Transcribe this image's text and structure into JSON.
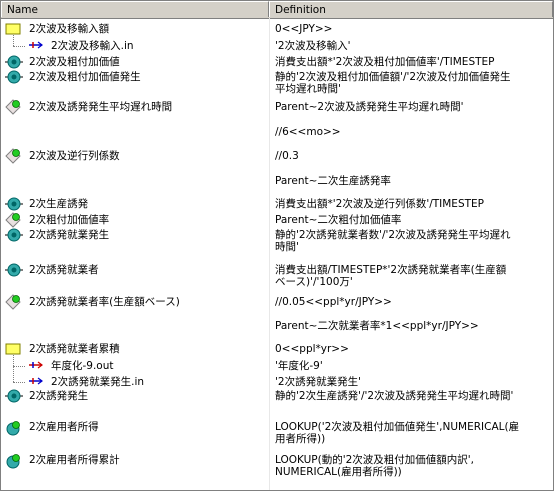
{
  "header": {
    "name_label": "Name",
    "definition_label": "Definition"
  },
  "rows": [
    {
      "name": "2次波及移輸入額",
      "def": [
        "0<<JPY>>"
      ],
      "icon": "level-icon"
    },
    {
      "name": "2次波及移輸入.in",
      "def": [
        "'2次波及移輸入'"
      ],
      "icon": "flow-in-icon"
    },
    {
      "name": "2次波及粗付加価値",
      "def": [
        "消費支出額*'2次波及粗付加価値率'/TIMESTEP"
      ],
      "icon": "flow-valve-icon"
    },
    {
      "name": "2次波及粗付加価値発生",
      "def": [
        "静的'2次波及粗付加価値額'/'2次波及付加価値発生",
        "平均遅れ時間'"
      ],
      "icon": "flow-valve-icon"
    },
    {
      "name": "2次波及誘発発生平均遅れ時間",
      "def": [
        "Parent~2次波及誘発発生平均遅れ時間'"
      ],
      "icon": "constant-icon"
    },
    {
      "name": "",
      "def": [
        "//6<<mo>>"
      ],
      "icon": ""
    },
    {
      "name": "2次波及逆行列係数",
      "def": [
        "//0.3"
      ],
      "icon": "constant-icon"
    },
    {
      "name": "",
      "def": [
        "Parent~二次生産誘発率"
      ],
      "icon": ""
    },
    {
      "name": "2次生産誘発",
      "def": [
        "消費支出額*'2次波及逆行列係数'/TIMESTEP"
      ],
      "icon": "flow-valve-icon"
    },
    {
      "name": "2次粗付加価値率",
      "def": [
        "Parent~二次粗付加価値率"
      ],
      "icon": "constant-icon"
    },
    {
      "name": "2次誘発就業発生",
      "def": [
        "静的'2次誘発就業者数'/'2次波及誘発発生平均遅れ",
        "時間'"
      ],
      "icon": "flow-valve-icon"
    },
    {
      "name": "2次誘発就業者",
      "def": [
        "消費支出額/TIMESTEP*'2次誘発就業者率(生産額",
        "ベース)'/'100万'"
      ],
      "icon": "flow-valve-icon"
    },
    {
      "name": "2次誘発就業者率(生産額ベース)",
      "def": [
        "//0.05<<ppl*yr/JPY>>"
      ],
      "icon": "constant-icon"
    },
    {
      "name": "",
      "def": [
        "Parent~二次就業者率*1<<ppl*yr/JPY>>"
      ],
      "icon": ""
    },
    {
      "name": "2次誘発就業者累積",
      "def": [
        "0<<ppl*yr>>"
      ],
      "icon": "level-icon"
    },
    {
      "name": "年度化-9.out",
      "def": [
        "'年度化-9'"
      ],
      "icon": "flow-out-icon"
    },
    {
      "name": "2次誘発就業発生.in",
      "def": [
        "'2次誘発就業発生'"
      ],
      "icon": "flow-in-icon"
    },
    {
      "name": "2次誘発発生",
      "def": [
        "静的'2次生産誘発'/'2次波及誘発発生平均遅れ時間'"
      ],
      "icon": "flow-valve-icon"
    },
    {
      "name": "2次雇用者所得",
      "def": [
        "LOOKUP('2次波及粗付加価値発生',NUMERICAL(雇",
        "用者所得))"
      ],
      "icon": "auxiliary-icon"
    },
    {
      "name": "2次雇用者所得累計",
      "def": [
        "LOOKUP(動的'2次波及粗付加価値額内訳',",
        "NUMERICAL(雇用者所得))"
      ],
      "icon": "auxiliary-icon"
    }
  ]
}
